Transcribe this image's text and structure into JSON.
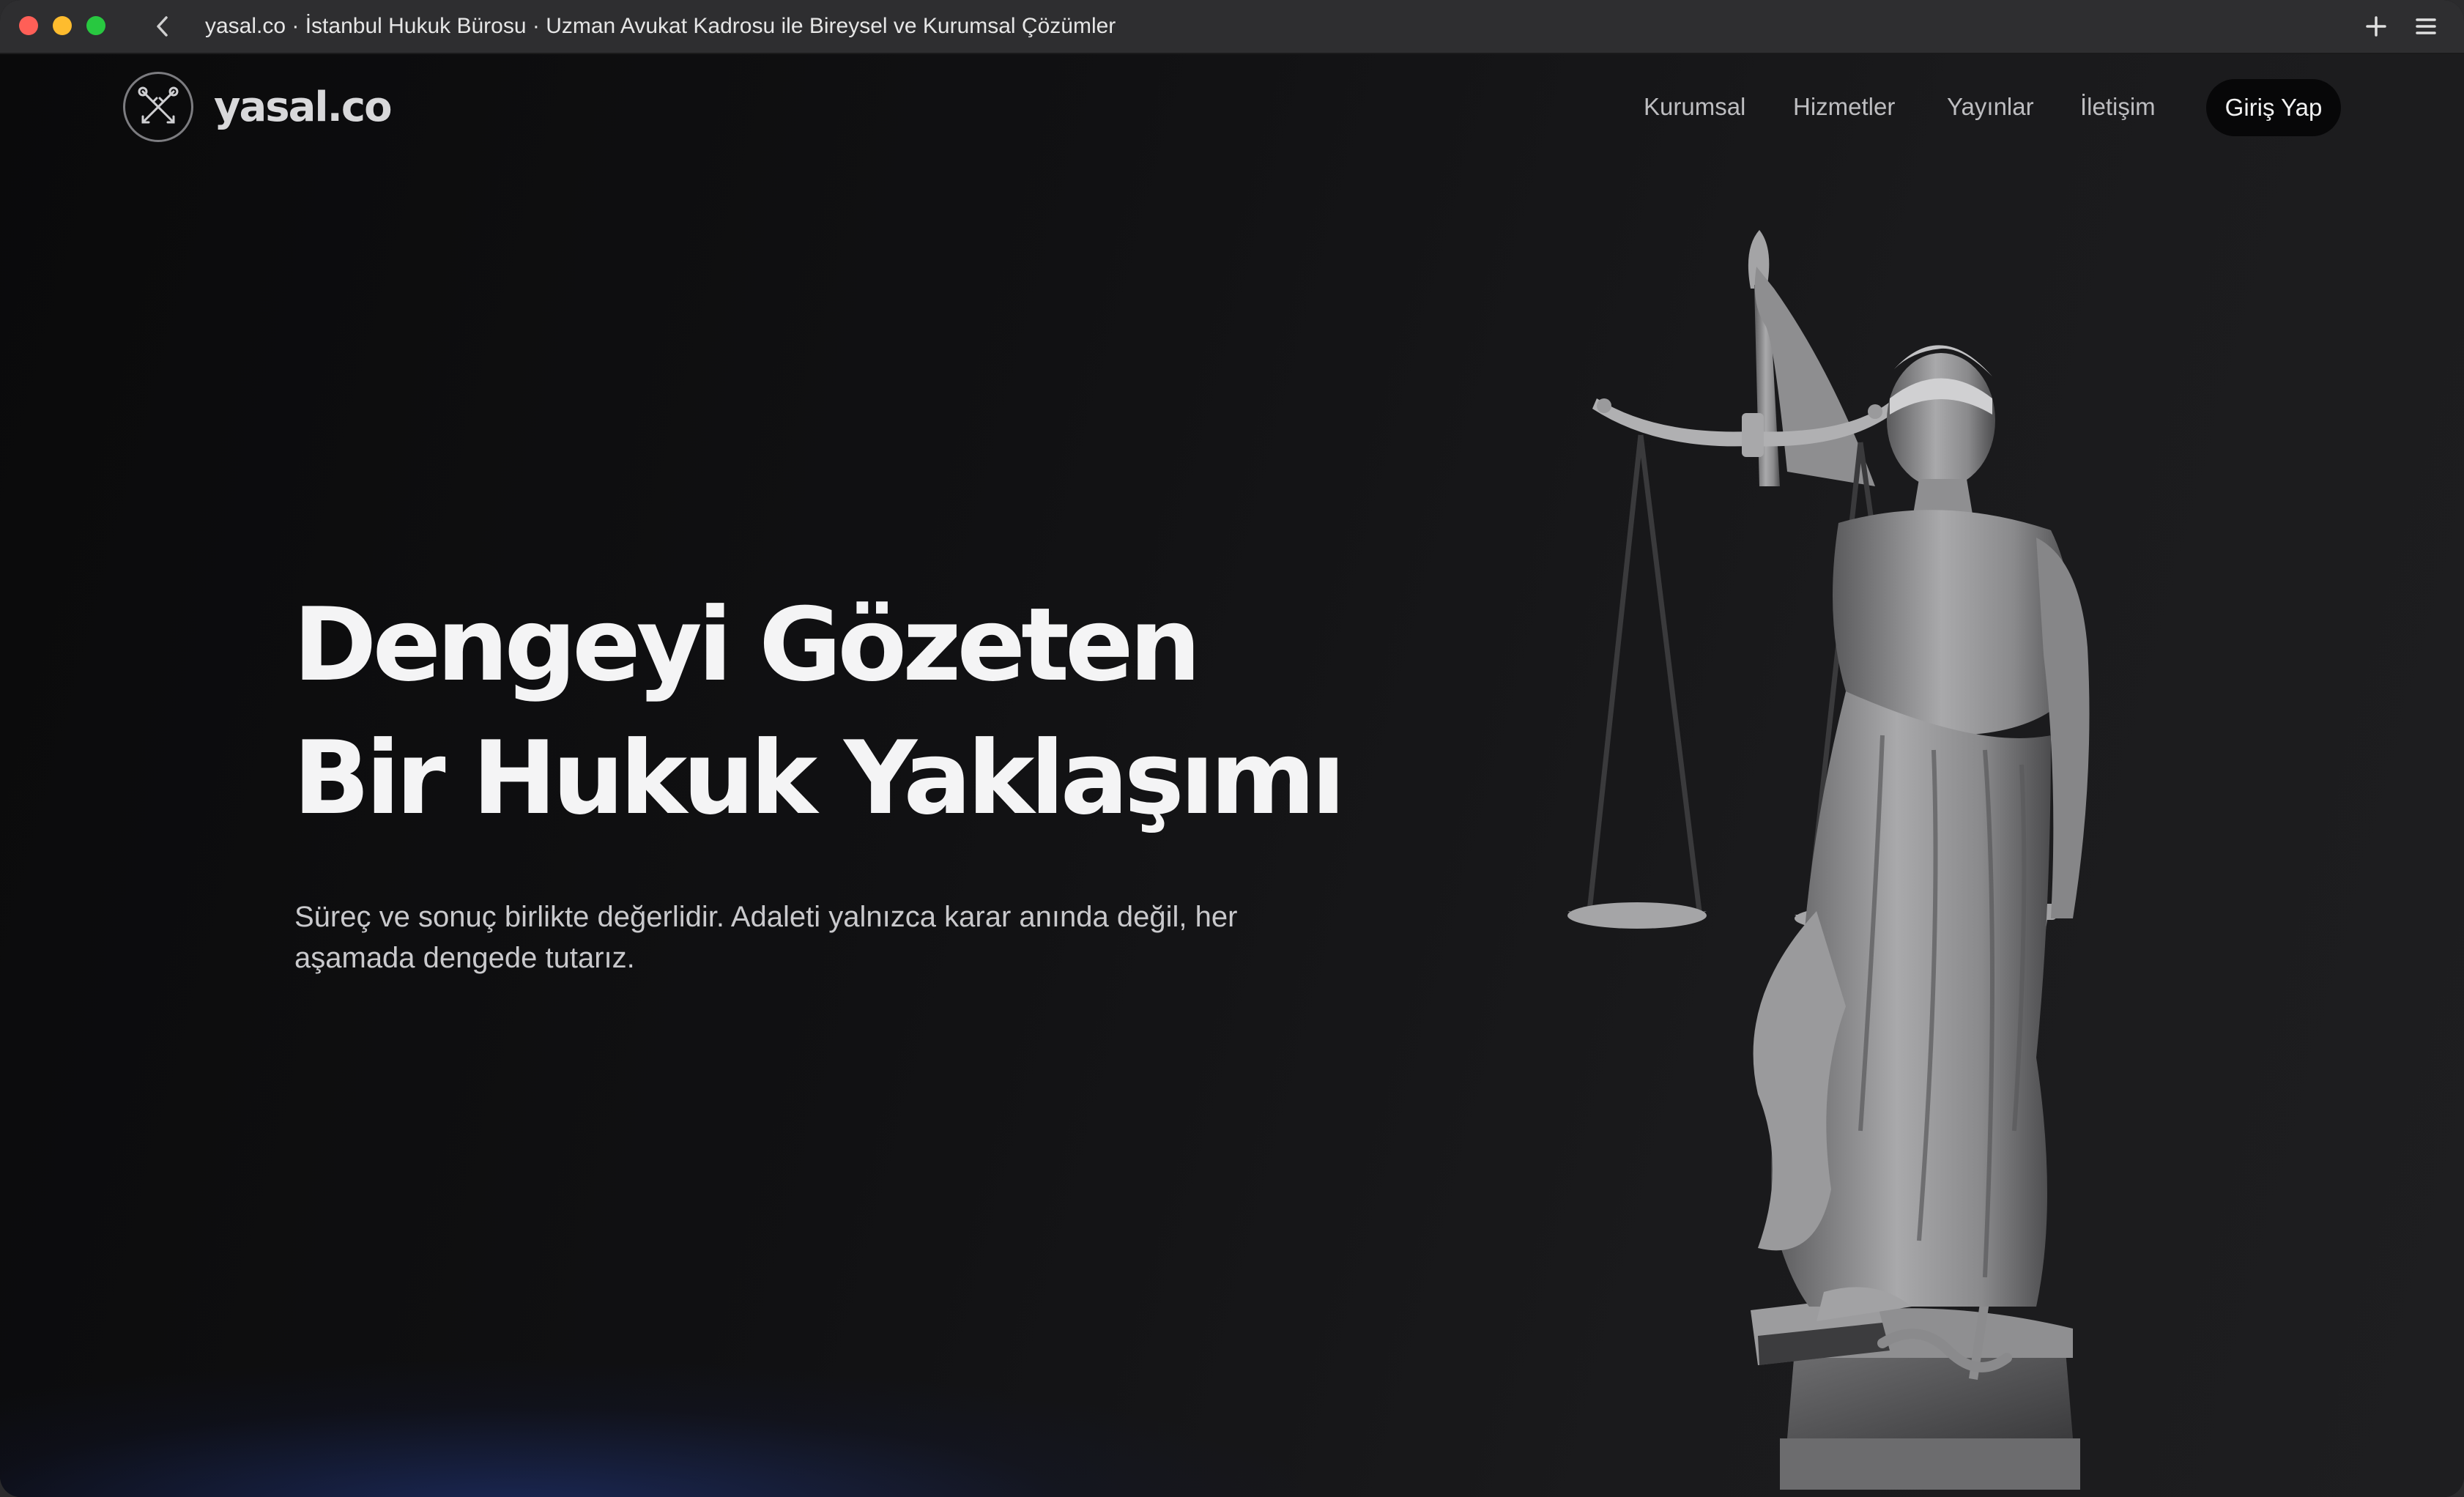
{
  "browser": {
    "tab_title": "yasal.co · İstanbul Hukuk Bürosu · Uzman Avukat Kadrosu ile Bireysel ve Kurumsal Çözümler",
    "back_icon": "chevron-left-icon",
    "new_tab_icon": "plus-icon",
    "menu_icon": "hamburger-icon"
  },
  "header": {
    "logo_text": "yasal.co",
    "logo_icon": "crossed-keys-icon",
    "nav": [
      {
        "label": "Kurumsal"
      },
      {
        "label": "Hizmetler"
      },
      {
        "label": "Yayınlar"
      },
      {
        "label": "İletişim"
      }
    ],
    "login_label": "Giriş Yap"
  },
  "hero": {
    "title_line1": "Dengeyi Gözeten",
    "title_line2": "Bir Hukuk Yaklaşımı",
    "subtitle": "Süreç ve sonuç birlikte değerlidir. Adaleti yalnızca karar anında değil, her aşamada dengede tutarız.",
    "image_subject": "lady-justice-statue"
  },
  "colors": {
    "background": "#0c0c0d",
    "text_primary": "#f4f4f5",
    "text_muted": "#bdbdc0",
    "accent_glow": "#2846aa"
  }
}
